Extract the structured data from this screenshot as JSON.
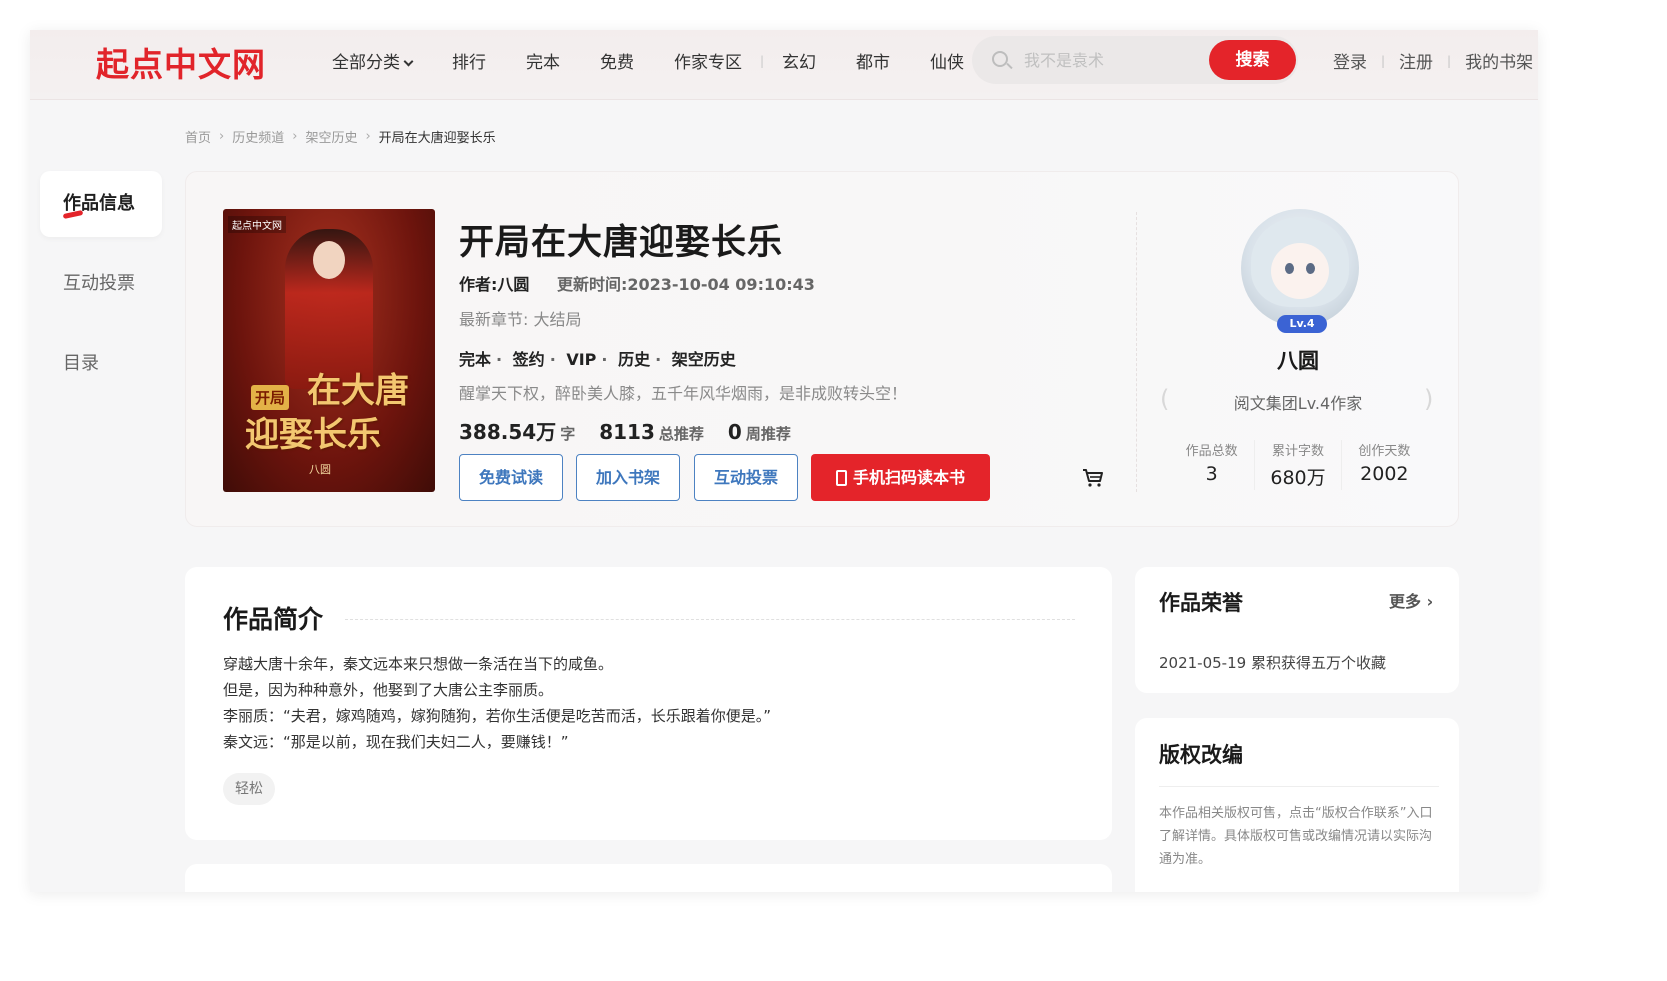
{
  "header": {
    "logo": "起点中文网",
    "nav": [
      "全部分类",
      "排行",
      "完本",
      "免费",
      "作家专区",
      "玄幻",
      "都市",
      "仙侠"
    ],
    "search_placeholder": "我不是袁术",
    "search_button": "搜索",
    "login": "登录",
    "register": "注册",
    "bookshelf": "我的书架"
  },
  "breadcrumb": [
    "首页",
    "历史频道",
    "架空历史",
    "开局在大唐迎娶长乐"
  ],
  "sidebar": [
    "作品信息",
    "互动投票",
    "目录"
  ],
  "book": {
    "cover_badge": "起点中文网",
    "cover_title_a": "在大唐",
    "cover_title_b": "迎娶长乐",
    "cover_tag": "开局",
    "cover_author": "八圆",
    "title": "开局在大唐迎娶长乐",
    "author": "作者:八圆",
    "updated": "更新时间:2023-10-04 09:10:43",
    "latest": "最新章节: 大结局",
    "tags": [
      "完本",
      "签约",
      "VIP",
      "历史",
      "架空历史"
    ],
    "slogan": "醒掌天下权，醉卧美人膝，五千年风华烟雨，是非成败转头空！",
    "words": "388.54万",
    "words_unit": "字",
    "total_rec": "8113",
    "total_rec_unit": "总推荐",
    "week_rec": "0",
    "week_rec_unit": "周推荐",
    "buttons": {
      "read": "免费试读",
      "shelf": "加入书架",
      "vote": "互动投票",
      "scan": "手机扫码读本书"
    }
  },
  "author": {
    "name": "八圆",
    "level": "Lv.4",
    "role": "阅文集团Lv.4作家",
    "stats": [
      {
        "label": "作品总数",
        "value": "3"
      },
      {
        "label": "累计字数",
        "value": "680万"
      },
      {
        "label": "创作天数",
        "value": "2002"
      }
    ]
  },
  "intro": {
    "heading": "作品简介",
    "lines": [
      "穿越大唐十余年，秦文远本来只想做一条活在当下的咸鱼。",
      "但是，因为种种意外，他娶到了大唐公主李丽质。",
      "李丽质：“夫君，嫁鸡随鸡，嫁狗随狗，若你生活便是吃苦而活，长乐跟着你便是。”",
      "秦文远：“那是以前，现在我们夫妇二人，要赚钱！”"
    ],
    "tag": "轻松"
  },
  "honor": {
    "heading": "作品荣誉",
    "more": "更多",
    "item": "2021-05-19 累积获得五万个收藏"
  },
  "copyright": {
    "heading": "版权改编",
    "text": "本作品相关版权可售，点击“版权合作联系”入口了解详情。具体版权可售或改编情况请以实际沟通为准。"
  }
}
